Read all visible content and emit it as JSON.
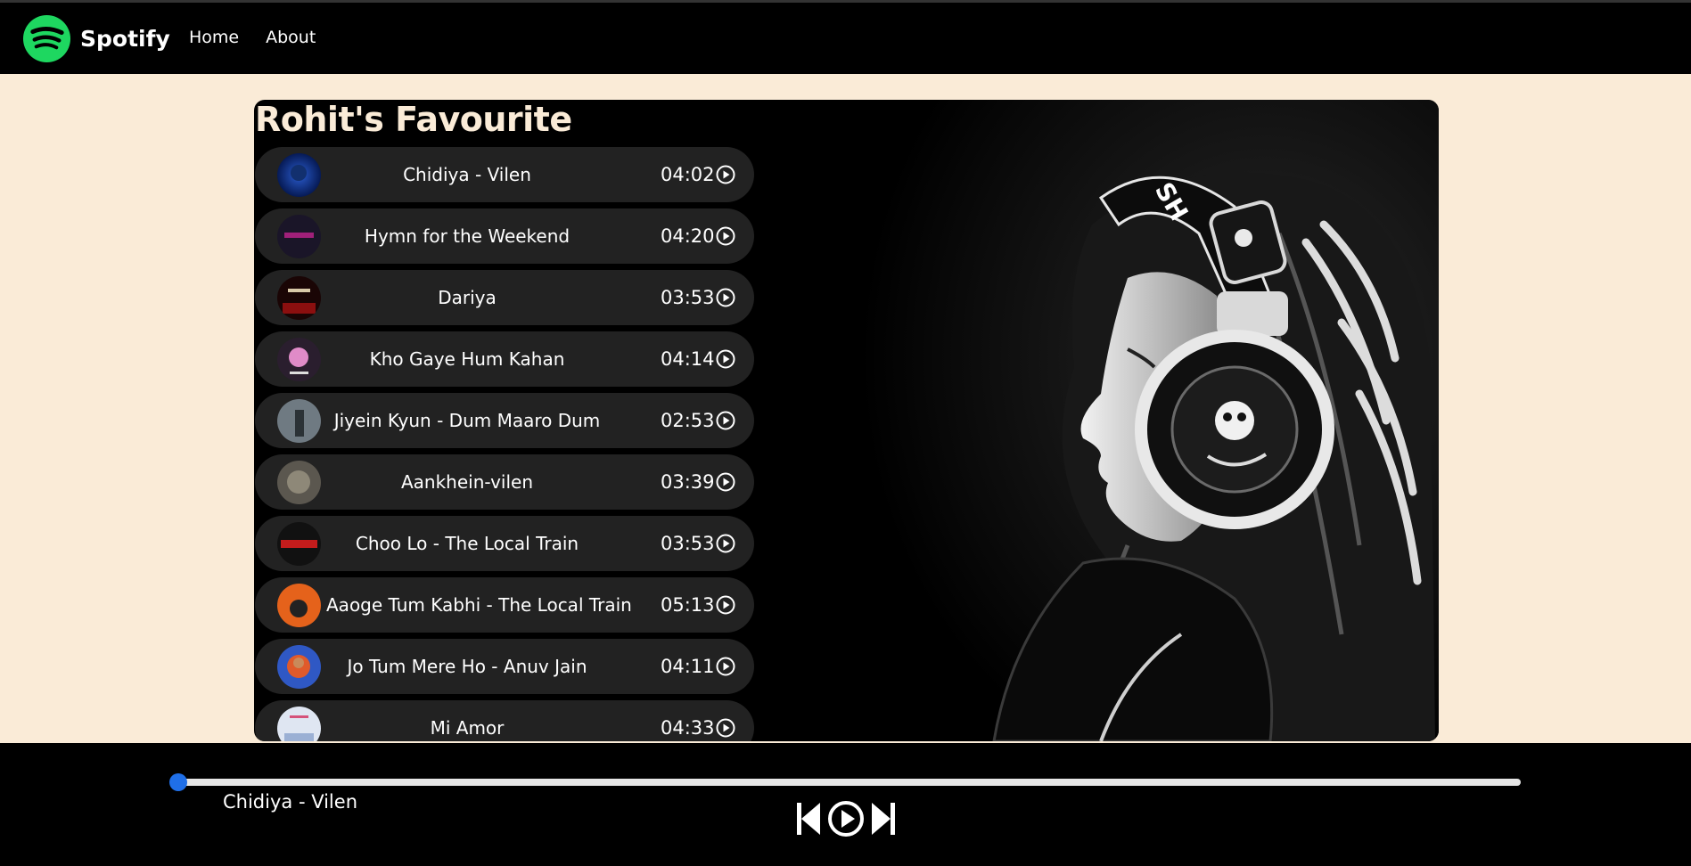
{
  "header": {
    "brand": "Spotify",
    "nav": [
      {
        "label": "Home"
      },
      {
        "label": "About"
      }
    ]
  },
  "playlist": {
    "title": "Rohit's Favourite",
    "songs": [
      {
        "title": "Chidiya - Vilen",
        "duration": "04:02"
      },
      {
        "title": "Hymn for the Weekend",
        "duration": "04:20"
      },
      {
        "title": "Dariya",
        "duration": "03:53"
      },
      {
        "title": "Kho Gaye Hum Kahan",
        "duration": "04:14"
      },
      {
        "title": "Jiyein Kyun - Dum Maaro Dum",
        "duration": "02:53"
      },
      {
        "title": "Aankhein-vilen",
        "duration": "03:39"
      },
      {
        "title": "Choo Lo - The Local Train",
        "duration": "03:53"
      },
      {
        "title": "Aaoge Tum Kabhi - The Local Train",
        "duration": "05:13"
      },
      {
        "title": "Jo Tum Mere Ho - Anuv Jain",
        "duration": "04:11"
      },
      {
        "title": "Mi Amor",
        "duration": "04:33"
      }
    ]
  },
  "player": {
    "now_playing": "Chidiya - Vilen",
    "progress": 0
  },
  "colors": {
    "brand_green": "#1ed760",
    "background": "#faebd7",
    "row_bg": "#222222",
    "slider_thumb": "#1f6fe8"
  }
}
